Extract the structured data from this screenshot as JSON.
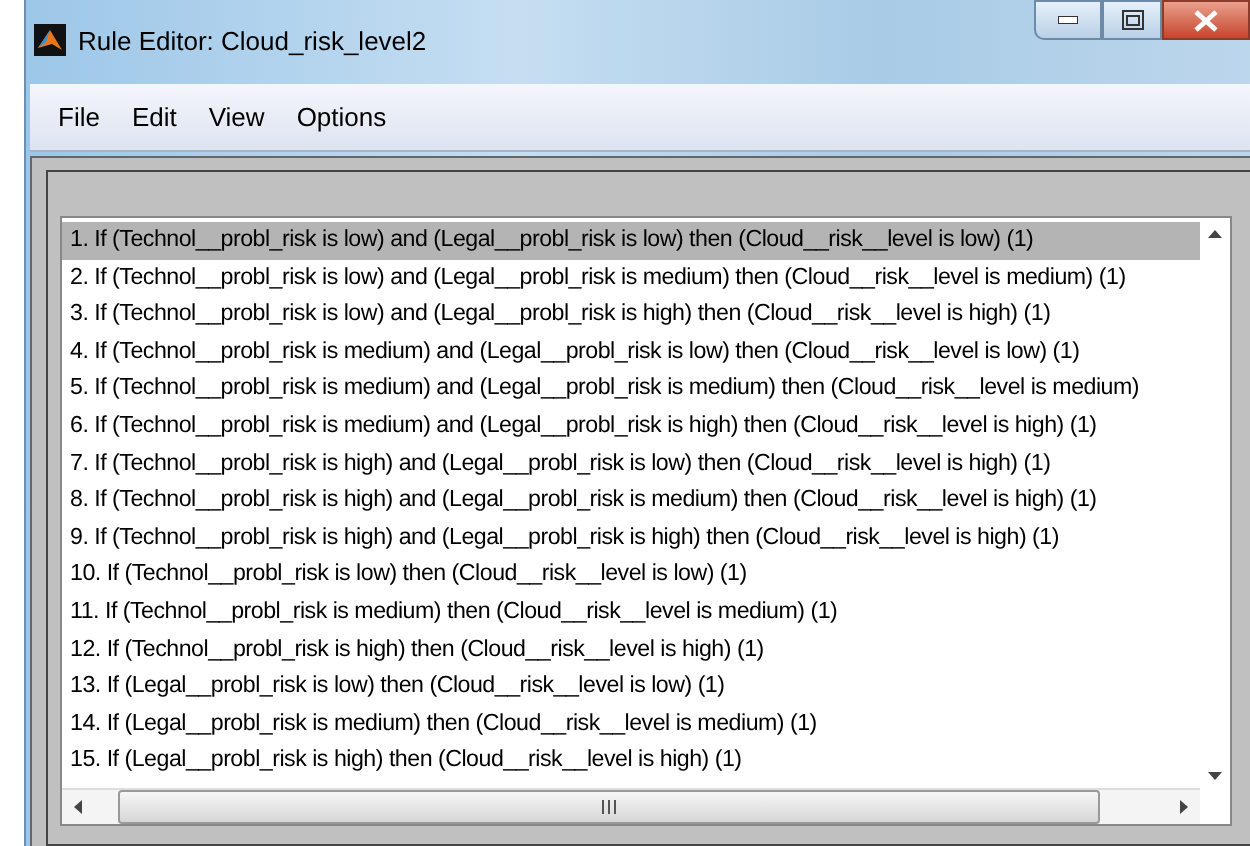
{
  "window": {
    "title": "Rule Editor: Cloud_risk_level2"
  },
  "menu": [
    "File",
    "Edit",
    "View",
    "Options"
  ],
  "rules": [
    {
      "text": "1. If (Technol__probl_risk is low) and (Legal__probl_risk is low) then (Cloud__risk__level is low) (1)",
      "selected": true
    },
    {
      "text": "2. If (Technol__probl_risk is low) and (Legal__probl_risk is medium) then (Cloud__risk__level is medium) (1)",
      "selected": false
    },
    {
      "text": "3. If (Technol__probl_risk is low) and (Legal__probl_risk is high) then (Cloud__risk__level is high) (1)",
      "selected": false
    },
    {
      "text": "4. If (Technol__probl_risk is medium) and (Legal__probl_risk is low) then (Cloud__risk__level is low) (1)",
      "selected": false
    },
    {
      "text": "5. If (Technol__probl_risk is medium) and (Legal__probl_risk is medium) then (Cloud__risk__level is medium)",
      "selected": false
    },
    {
      "text": "6. If (Technol__probl_risk is medium) and (Legal__probl_risk is high) then (Cloud__risk__level is high) (1)",
      "selected": false
    },
    {
      "text": "7. If (Technol__probl_risk is high) and (Legal__probl_risk is low) then (Cloud__risk__level is high) (1)",
      "selected": false
    },
    {
      "text": "8. If (Technol__probl_risk is high) and (Legal__probl_risk is medium) then (Cloud__risk__level is high) (1)",
      "selected": false
    },
    {
      "text": "9. If (Technol__probl_risk is high) and (Legal__probl_risk is high) then (Cloud__risk__level is high) (1)",
      "selected": false
    },
    {
      "text": "10. If (Technol__probl_risk is low) then (Cloud__risk__level is low) (1)",
      "selected": false
    },
    {
      "text": "11. If (Technol__probl_risk is medium) then (Cloud__risk__level is medium) (1)",
      "selected": false
    },
    {
      "text": "12. If (Technol__probl_risk is high) then (Cloud__risk__level is high) (1)",
      "selected": false
    },
    {
      "text": "13. If (Legal__probl_risk is low) then (Cloud__risk__level is low) (1)",
      "selected": false
    },
    {
      "text": "14. If (Legal__probl_risk is medium) then (Cloud__risk__level is medium) (1)",
      "selected": false
    },
    {
      "text": "15. If (Legal__probl_risk is high) then (Cloud__risk__level is high) (1)",
      "selected": false
    }
  ]
}
